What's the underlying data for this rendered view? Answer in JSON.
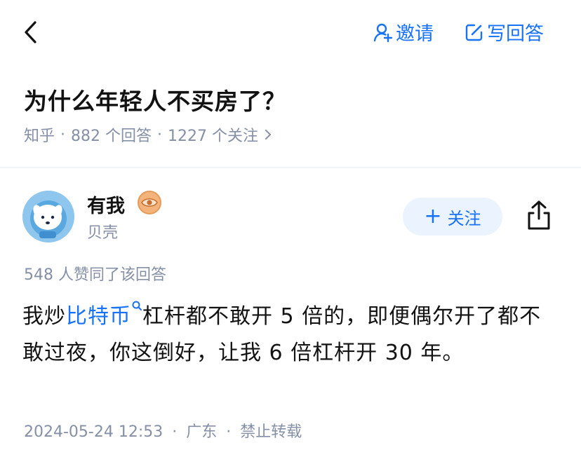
{
  "topbar": {
    "back_icon": "chevron-left-icon",
    "invite_label": "邀请",
    "invite_icon": "person-add-icon",
    "write_label": "写回答",
    "write_icon": "edit-icon"
  },
  "question": {
    "title": "为什么年轻人不买房了？",
    "source": "知乎",
    "answers_count": "882 个回答",
    "followers_count": "1227 个关注"
  },
  "author": {
    "name": "有我",
    "badge_icon": "eye-badge-icon",
    "description": "贝壳",
    "follow_label": "关注",
    "share_icon": "share-icon"
  },
  "answer": {
    "votes_text": "548 人赞同了该回答",
    "content_pre": "我炒",
    "content_link": "比特币",
    "content_post": "杠杆都不敢开 5 倍的，即便偶尔开了都不敢过夜，你这倒好，让我 6 倍杠杆开 30 年。",
    "date": "2024-05-24 12:53",
    "location": "广东",
    "copyright": "禁止转载"
  },
  "colors": {
    "accent": "#1772f6",
    "meta": "#8590a6",
    "text": "#121212"
  }
}
